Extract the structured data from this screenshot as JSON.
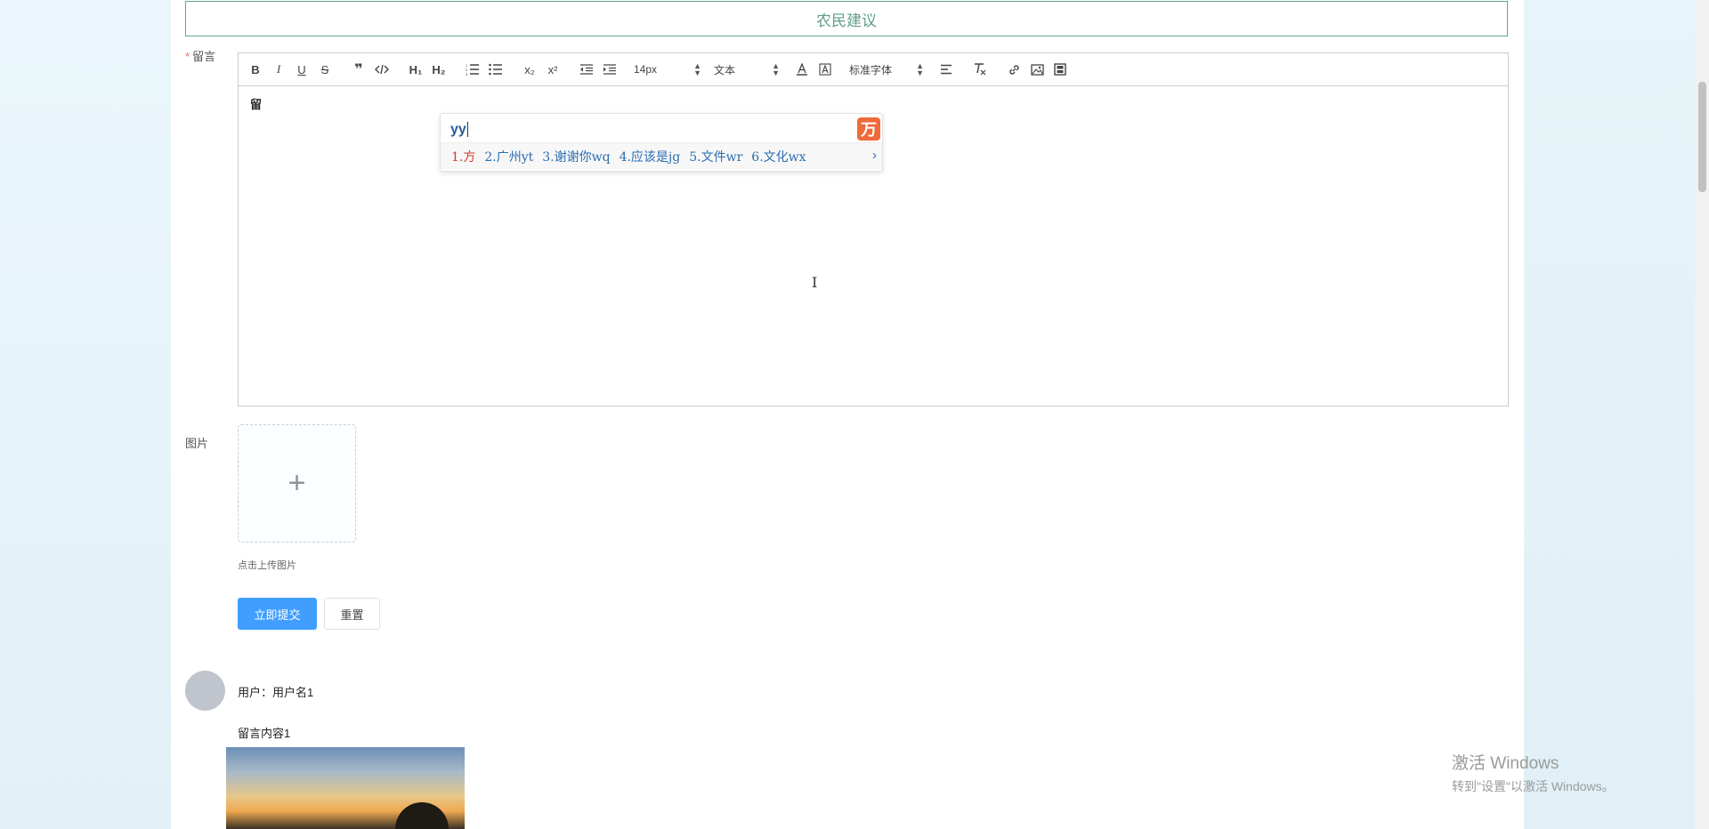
{
  "page_title": "农民建议",
  "form": {
    "message_label": "留言",
    "required_mark": "*",
    "image_label": "图片",
    "upload_tip": "点击上传图片",
    "upload_plus": "+",
    "submit_label": "立即提交",
    "reset_label": "重置"
  },
  "toolbar": {
    "font_size": "14px",
    "block_format": "文本",
    "font_family": "标准字体",
    "heading1": "H₁",
    "heading2": "H₂",
    "subscript": "x₂",
    "superscript": "x²",
    "bold": "B",
    "italic": "I",
    "underline": "U",
    "strike": "S",
    "quote": "❞"
  },
  "editor": {
    "content": "留"
  },
  "ime": {
    "input": "yy",
    "candidates": [
      "1.方",
      "2.广州yt",
      "3.谢谢你wq",
      "4.应该是jg",
      "5.文件wr",
      "6.文化wx"
    ],
    "logo": "万",
    "next": "›"
  },
  "comment": {
    "user_line": "用户：用户名1",
    "content": "留言内容1"
  },
  "watermark": {
    "line1": "激活 Windows",
    "line2": "转到\"设置\"以激活 Windows。"
  },
  "colors": {
    "primary": "#409eff",
    "title_border": "#5fa88e",
    "required": "#f56c6c"
  }
}
